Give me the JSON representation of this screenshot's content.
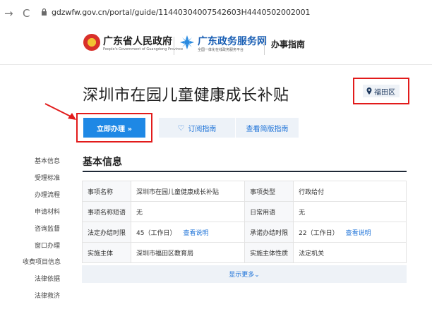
{
  "browser": {
    "url": "gdzwfw.gov.cn/portal/guide/11440304007542603H4440502002001"
  },
  "header": {
    "gov_title": "广东省人民政府",
    "gov_subtitle": "People's Government of Guangdong Province",
    "service_title": "广东政务服务网",
    "service_subtitle": "全国一体化在线政务服务平台",
    "guide_label": "办事指南"
  },
  "main": {
    "title": "深圳市在园儿童健康成长补贴",
    "region": "福田区",
    "apply_label": "立即办理 »",
    "subscribe_label": "订阅指南",
    "simple_label": "查看简版指南"
  },
  "sidebar": {
    "items": [
      {
        "label": "基本信息"
      },
      {
        "label": "受理标准"
      },
      {
        "label": "办理流程"
      },
      {
        "label": "申请材料"
      },
      {
        "label": "咨询监督"
      },
      {
        "label": "窗口办理"
      },
      {
        "label": "收费项目信息"
      },
      {
        "label": "法律依据"
      },
      {
        "label": "法律救济"
      }
    ]
  },
  "basic_info": {
    "title": "基本信息",
    "rows": [
      {
        "k1": "事项名称",
        "v1": "深圳市在园儿童健康成长补贴",
        "k2": "事项类型",
        "v2": "行政给付"
      },
      {
        "k1": "事项名称短语",
        "v1": "无",
        "k2": "日常用语",
        "v2": "无"
      },
      {
        "k1": "法定办结时限",
        "v1": "45（工作日）",
        "v1_link": "查看说明",
        "k2": "承诺办结时限",
        "v2": "22（工作日）",
        "v2_link": "查看说明"
      },
      {
        "k1": "实施主体",
        "v1": "深圳市福田区教育局",
        "k2": "实施主体性质",
        "v2": "法定机关"
      }
    ],
    "more_label": "显示更多⌄"
  },
  "colors": {
    "accent": "#1e88e5",
    "highlight": "#e21b1b",
    "link": "#1e73d8"
  }
}
